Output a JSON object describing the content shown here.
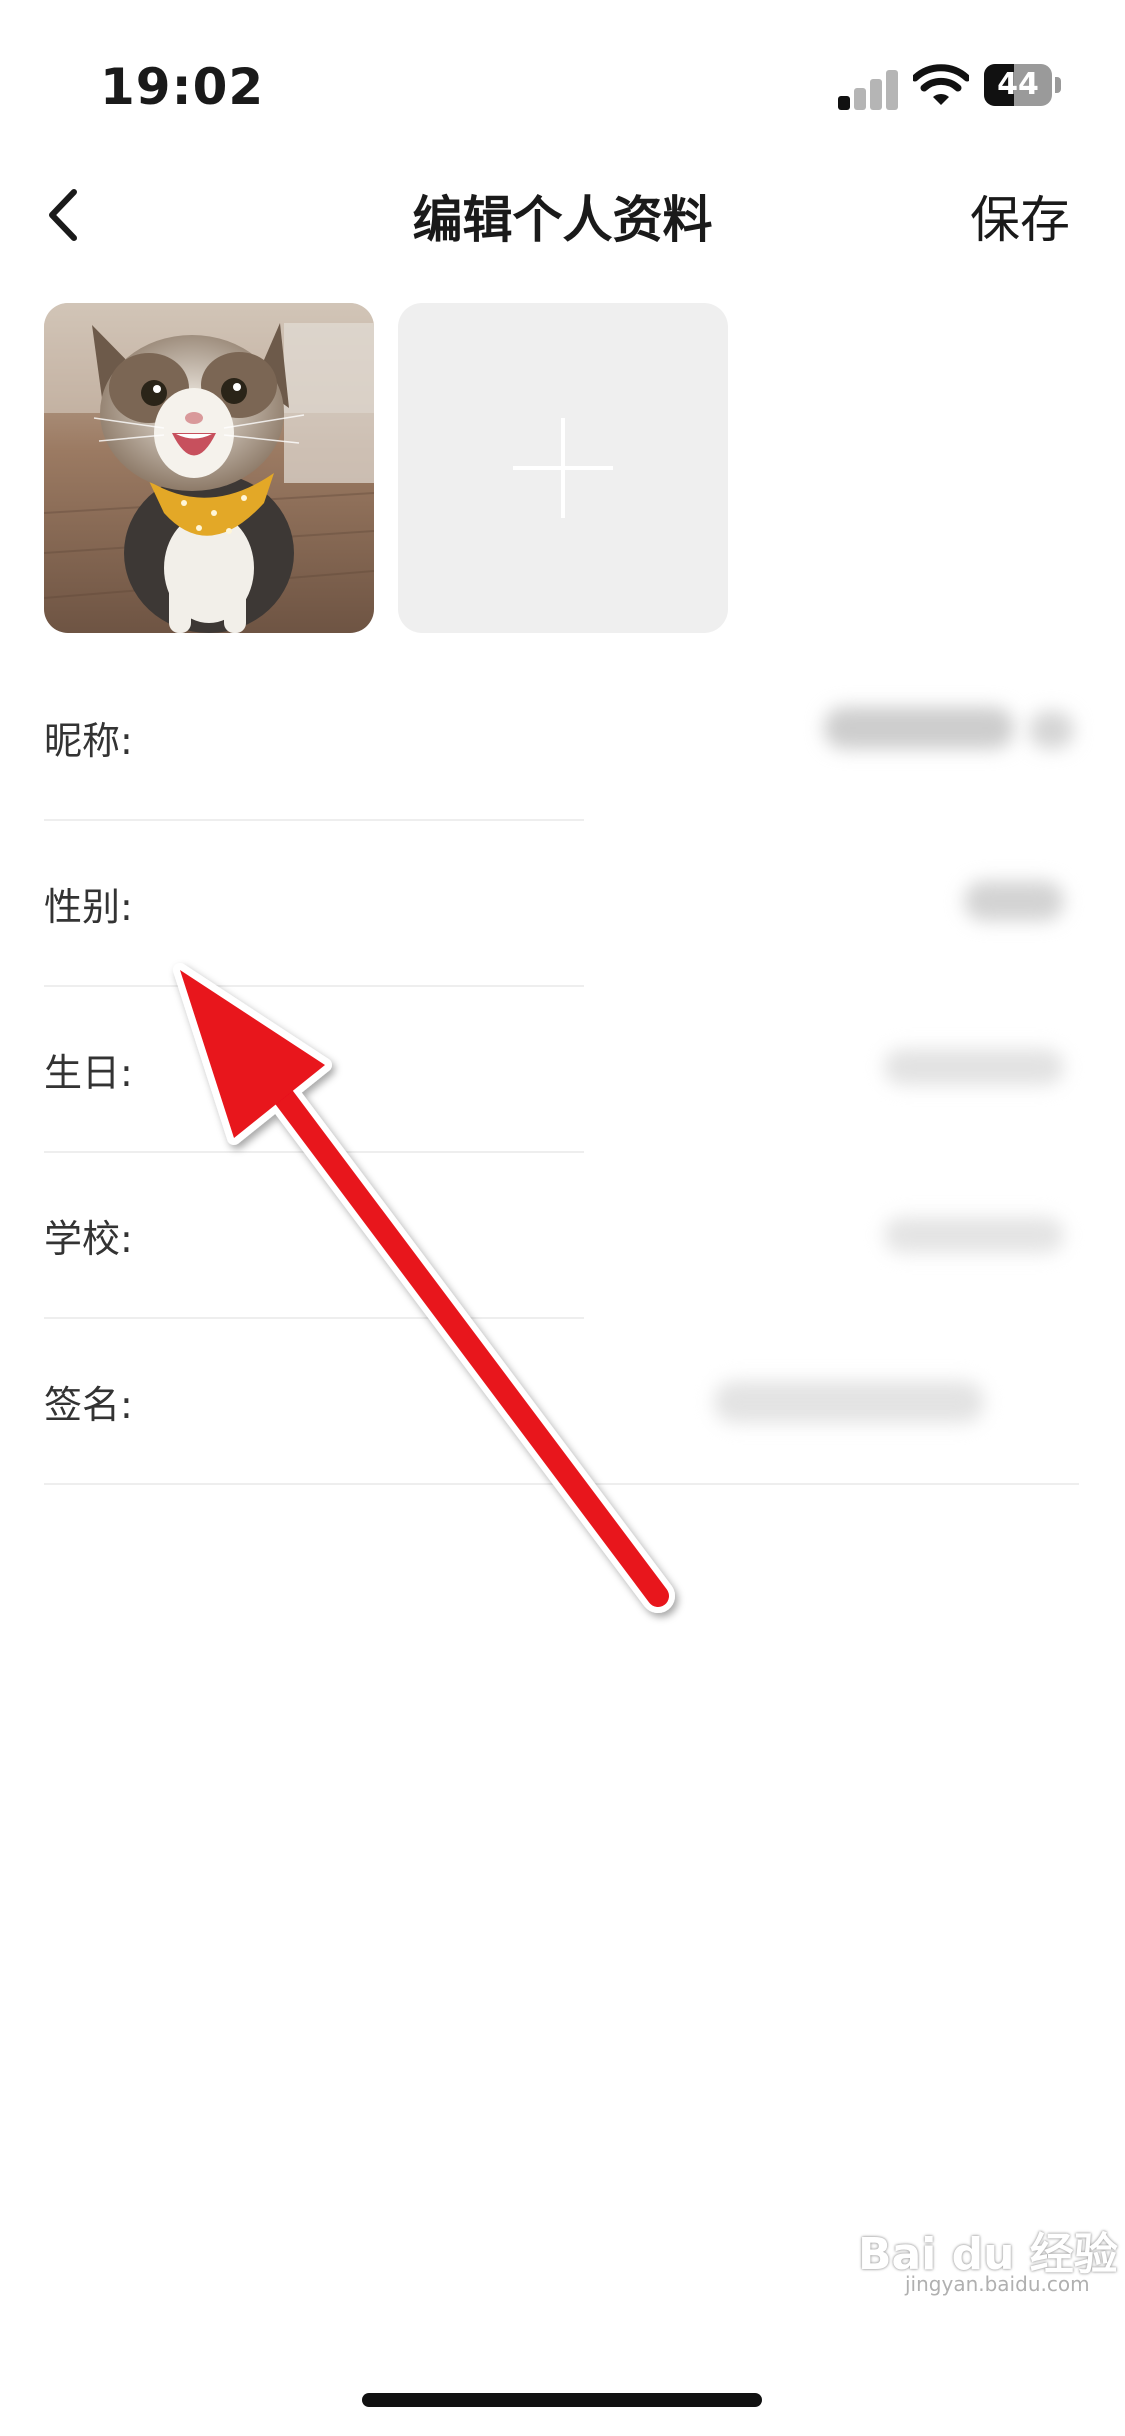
{
  "status_bar": {
    "time": "19:02",
    "battery": "44",
    "battery_level": 0.44
  },
  "nav": {
    "title": "编辑个人资料",
    "save_label": "保存"
  },
  "form": {
    "fields": [
      {
        "label": "昵称:"
      },
      {
        "label": "性别:"
      },
      {
        "label": "生日:"
      },
      {
        "label": "学校:"
      },
      {
        "label": "签名:"
      }
    ]
  },
  "watermark": {
    "brand": "Bai du 经验",
    "url": "jingyan.baidu.com"
  },
  "colors": {
    "arrow": "#e8121c",
    "placeholder_bg": "#efefef",
    "divider": "#eeeeee"
  },
  "icons": {
    "back": "chevron-left-icon",
    "add": "plus-icon"
  }
}
